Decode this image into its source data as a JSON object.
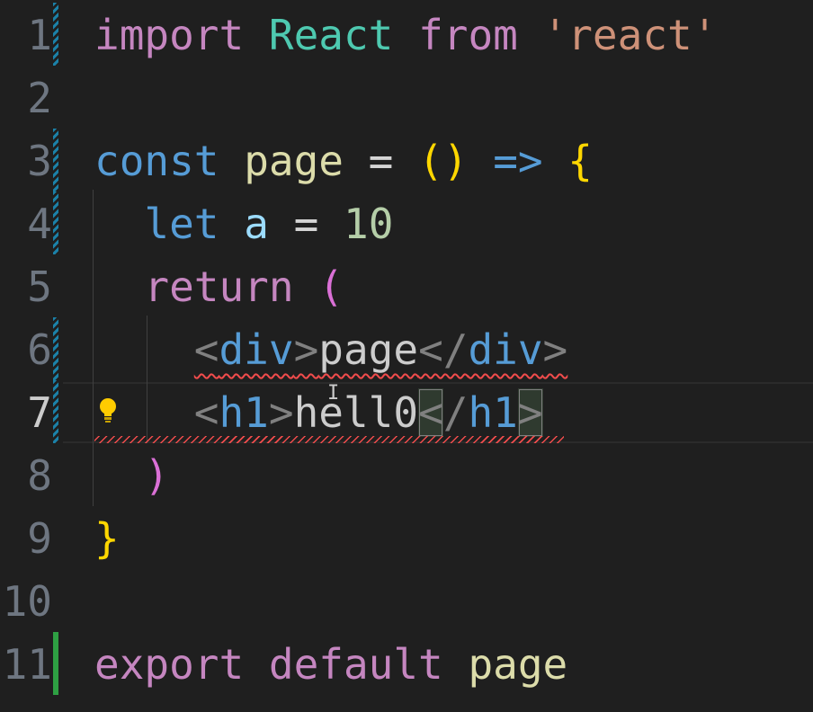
{
  "editor": {
    "lines": [
      {
        "number": "1",
        "tokens": [
          "import",
          "React",
          "from",
          "'react'"
        ]
      },
      {
        "number": "2"
      },
      {
        "number": "3",
        "tokens": [
          "const",
          "page",
          "=",
          "(",
          ")",
          "=>",
          "{"
        ]
      },
      {
        "number": "4",
        "tokens": [
          "let",
          "a",
          "=",
          "10"
        ]
      },
      {
        "number": "5",
        "tokens": [
          "return",
          "("
        ]
      },
      {
        "number": "6",
        "tokens": [
          "<",
          "div",
          ">",
          "page",
          "</",
          "div",
          ">"
        ]
      },
      {
        "number": "7",
        "tokens": [
          "<",
          "h1",
          ">",
          "hell0",
          "<",
          "/",
          "h1",
          ">"
        ]
      },
      {
        "number": "8",
        "tokens": [
          ")"
        ]
      },
      {
        "number": "9",
        "tokens": [
          "}"
        ]
      },
      {
        "number": "10"
      },
      {
        "number": "11",
        "tokens": [
          "export",
          "default",
          "page"
        ]
      }
    ],
    "active_line": "7",
    "lightbulb_icon": "lightbulb-icon",
    "gutter_colors": {
      "modified": "#1b81a8",
      "added": "#2ea043"
    },
    "syntax_colors": {
      "keyword_control": "#c586c0",
      "keyword_storage": "#569cd6",
      "type": "#4ec9b0",
      "string": "#ce9178",
      "function": "#dcdcaa",
      "bracket_level1": "#ffd700",
      "bracket_level2": "#da70d6",
      "number": "#b5cea8",
      "error_squiggle": "#f14c4c"
    }
  }
}
